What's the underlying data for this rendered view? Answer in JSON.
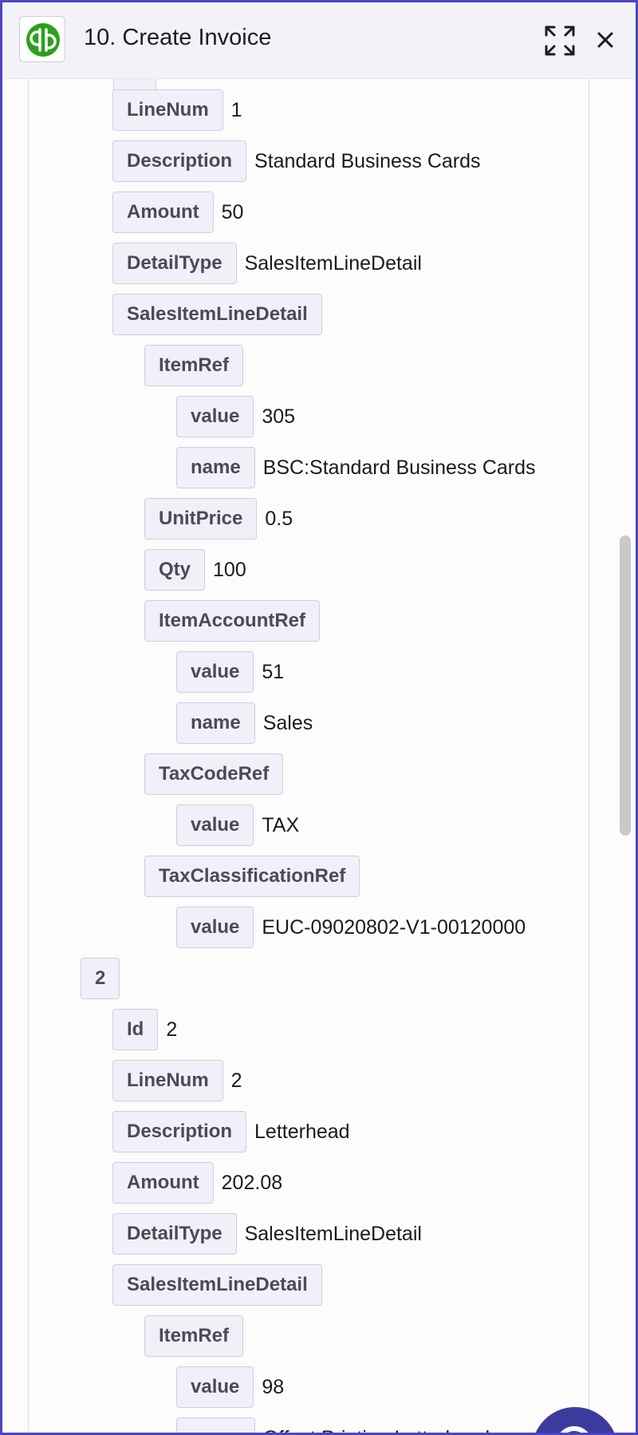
{
  "header": {
    "title": "10. Create Invoice",
    "icons": {
      "app": "quickbooks-logo-icon",
      "expand": "expand-icon",
      "close": "close-icon"
    }
  },
  "colors": {
    "frame_border": "#4b46c2",
    "brand_green": "#2ca01c",
    "key_bg": "#f1f0f8",
    "key_border": "#cfcce6",
    "fab": "#3d3a9e"
  },
  "lines": [
    {
      "key": "LineNum",
      "value": "1"
    },
    {
      "key": "Description",
      "value": "Standard Business Cards"
    },
    {
      "key": "Amount",
      "value": "50"
    },
    {
      "key": "DetailType",
      "value": "SalesItemLineDetail"
    },
    {
      "key": "SalesItemLineDetail",
      "value": ""
    },
    {
      "key": "ItemRef",
      "value": ""
    },
    {
      "key": "value",
      "value": "305"
    },
    {
      "key": "name",
      "value": "BSC:Standard Business Cards"
    },
    {
      "key": "UnitPrice",
      "value": "0.5"
    },
    {
      "key": "Qty",
      "value": "100"
    },
    {
      "key": "ItemAccountRef",
      "value": ""
    },
    {
      "key": "value",
      "value": "51"
    },
    {
      "key": "name",
      "value": "Sales"
    },
    {
      "key": "TaxCodeRef",
      "value": ""
    },
    {
      "key": "value",
      "value": "TAX"
    },
    {
      "key": "TaxClassificationRef",
      "value": ""
    },
    {
      "key": "value",
      "value": "EUC-09020802-V1-00120000"
    },
    {
      "key": "2",
      "value": ""
    },
    {
      "key": "Id",
      "value": "2"
    },
    {
      "key": "LineNum",
      "value": "2"
    },
    {
      "key": "Description",
      "value": "Letterhead"
    },
    {
      "key": "Amount",
      "value": "202.08"
    },
    {
      "key": "DetailType",
      "value": "SalesItemLineDetail"
    },
    {
      "key": "SalesItemLineDetail",
      "value": ""
    },
    {
      "key": "ItemRef",
      "value": ""
    },
    {
      "key": "value",
      "value": "98"
    },
    {
      "key": "name",
      "value": "Offset Printing:Letterhead"
    }
  ]
}
